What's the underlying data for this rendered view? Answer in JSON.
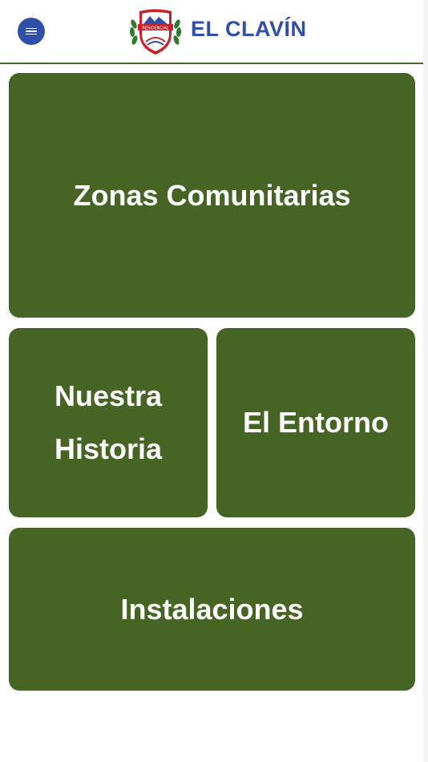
{
  "header": {
    "menu_icon": "hamburger-menu-icon",
    "logo": {
      "badge_text": "RESIDENCIAL",
      "icon": "shield-crest-logo"
    },
    "brand": "EL CLAVÍN"
  },
  "tiles": {
    "zonas": "Zonas Comunitarias",
    "historia_line1": "Nuestra",
    "historia_line2": "Historia",
    "entorno": "El Entorno",
    "instalaciones": "Instalaciones"
  },
  "colors": {
    "accent_blue": "#2f4fa8",
    "tile_green": "#466525",
    "logo_red": "#c8232a",
    "tile_text": "#ffffff"
  }
}
